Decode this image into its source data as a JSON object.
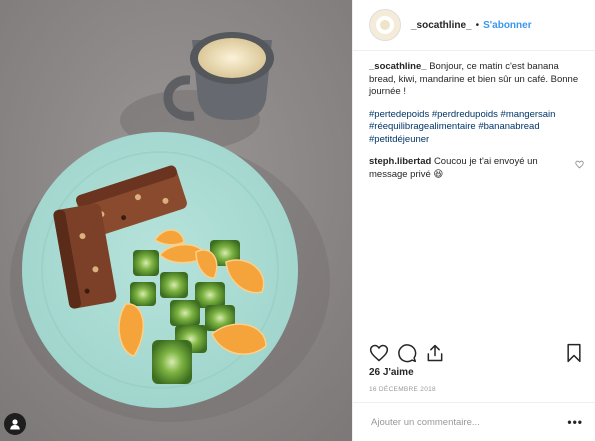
{
  "post": {
    "username": "_socathline_",
    "separator": "•",
    "follow_label": "S'abonner",
    "caption": {
      "user": "_socathline_",
      "text": "Bonjour, ce matin c'est banana bread, kiwi, mandarine et bien sûr un café. Bonne journée !"
    },
    "hashtags": [
      "#pertedepoids",
      "#perdredupoids",
      "#mangersain",
      "#réequilibragealimentaire",
      "#bananabread",
      "#petitdéjeuner"
    ],
    "reply": {
      "user": "steph.libertad",
      "text": "Coucou je t'ai envoyé un message privé 😆"
    },
    "likes": "26 J'aime",
    "date": "16 DÉCEMBRE 2018",
    "comment_placeholder": "Ajouter un commentaire...",
    "more_label": "•••"
  },
  "icons": {
    "like": "heart-icon",
    "comment": "comment-icon",
    "share": "share-icon",
    "save": "bookmark-icon",
    "reply_like": "small-heart-icon",
    "user_badge": "user-icon"
  },
  "colors": {
    "link": "#3897f0",
    "hashtag": "#003569",
    "muted": "#999999",
    "border": "#efefef"
  }
}
